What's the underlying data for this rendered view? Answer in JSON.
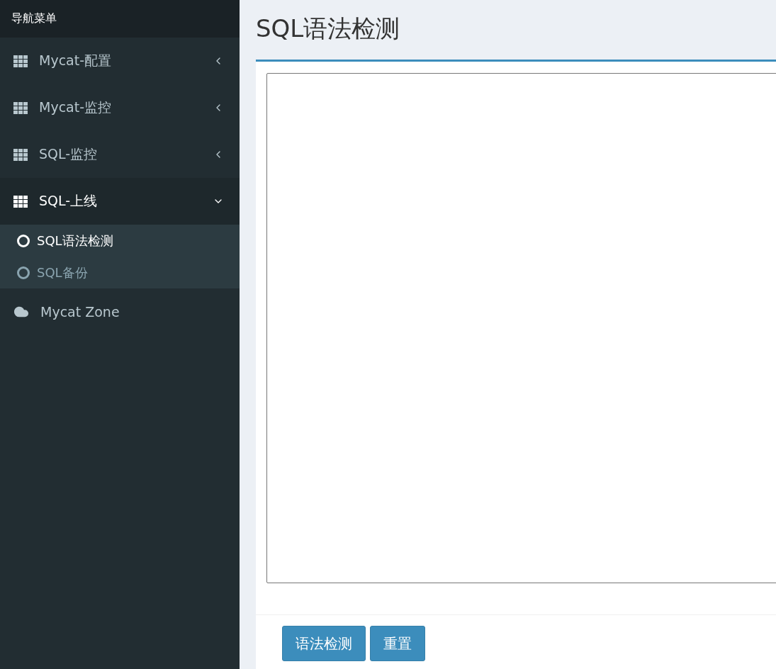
{
  "sidebar": {
    "header": "导航菜单",
    "items": [
      {
        "label": "Mycat-配置",
        "kind": "group",
        "expanded": false
      },
      {
        "label": "Mycat-监控",
        "kind": "group",
        "expanded": false
      },
      {
        "label": "SQL-监控",
        "kind": "group",
        "expanded": false
      },
      {
        "label": "SQL-上线",
        "kind": "group",
        "expanded": true,
        "children": [
          {
            "label": "SQL语法检测",
            "selected": true
          },
          {
            "label": "SQL备份",
            "selected": false
          }
        ]
      },
      {
        "label": "Mycat Zone",
        "kind": "link"
      }
    ]
  },
  "page": {
    "title": "SQL语法检测"
  },
  "buttons": [
    "语法检测",
    "重置"
  ]
}
